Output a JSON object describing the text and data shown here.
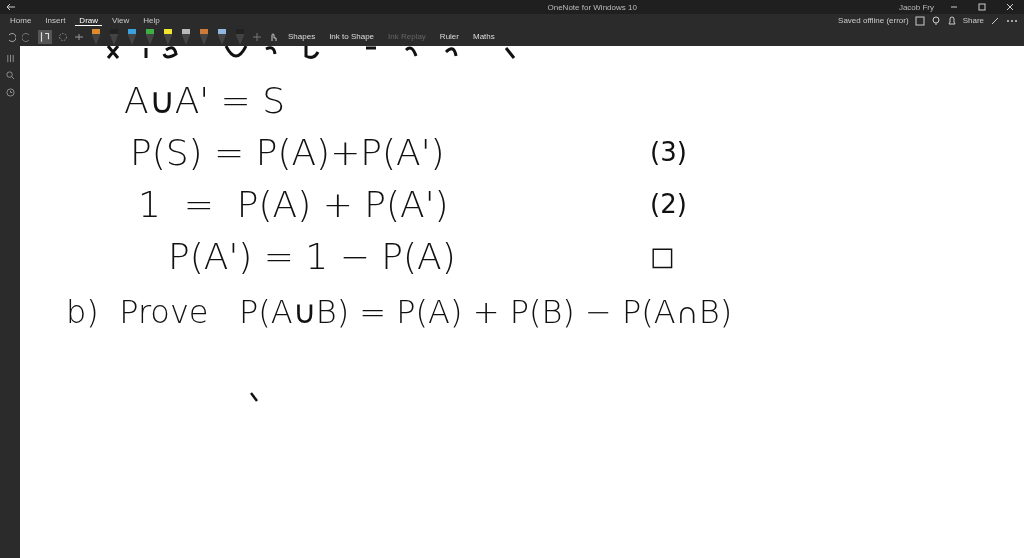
{
  "window": {
    "title": "OneNote for Windows 10",
    "user": "Jacob Fry"
  },
  "tabs": [
    {
      "label": "Home",
      "selected": false
    },
    {
      "label": "Insert",
      "selected": false
    },
    {
      "label": "Draw",
      "selected": true
    },
    {
      "label": "View",
      "selected": false
    },
    {
      "label": "Help",
      "selected": false
    }
  ],
  "status": "Saved offline (error)",
  "share": "Share",
  "pens": [
    {
      "color": "#e08a2c"
    },
    {
      "color": "#222222"
    },
    {
      "color": "#3aa0e0"
    },
    {
      "color": "#3cb043"
    },
    {
      "color": "#f2e530"
    },
    {
      "color": "#b8b8b8"
    },
    {
      "color": "#d07a3a"
    },
    {
      "color": "#8fb8e0"
    },
    {
      "color": "#222222"
    }
  ],
  "tools": [
    {
      "label": "Shapes",
      "disabled": false
    },
    {
      "label": "Ink to Shape",
      "disabled": false
    },
    {
      "label": "Ink Replay",
      "disabled": true
    },
    {
      "label": "Ruler",
      "disabled": false
    },
    {
      "label": "Maths",
      "disabled": false
    }
  ],
  "ink": [
    {
      "text": "A∪A' = S"
    },
    {
      "text": "P(S) = P(A)+P(A')",
      "note": "(3)"
    },
    {
      "text": "1  =  P(A) + P(A')",
      "note": "(2)"
    },
    {
      "text": "P(A') = 1 − P(A)",
      "note": "□"
    },
    {
      "text": "b)  Prove   P(A∪B) = P(A) + P(B) − P(A∩B)"
    }
  ]
}
